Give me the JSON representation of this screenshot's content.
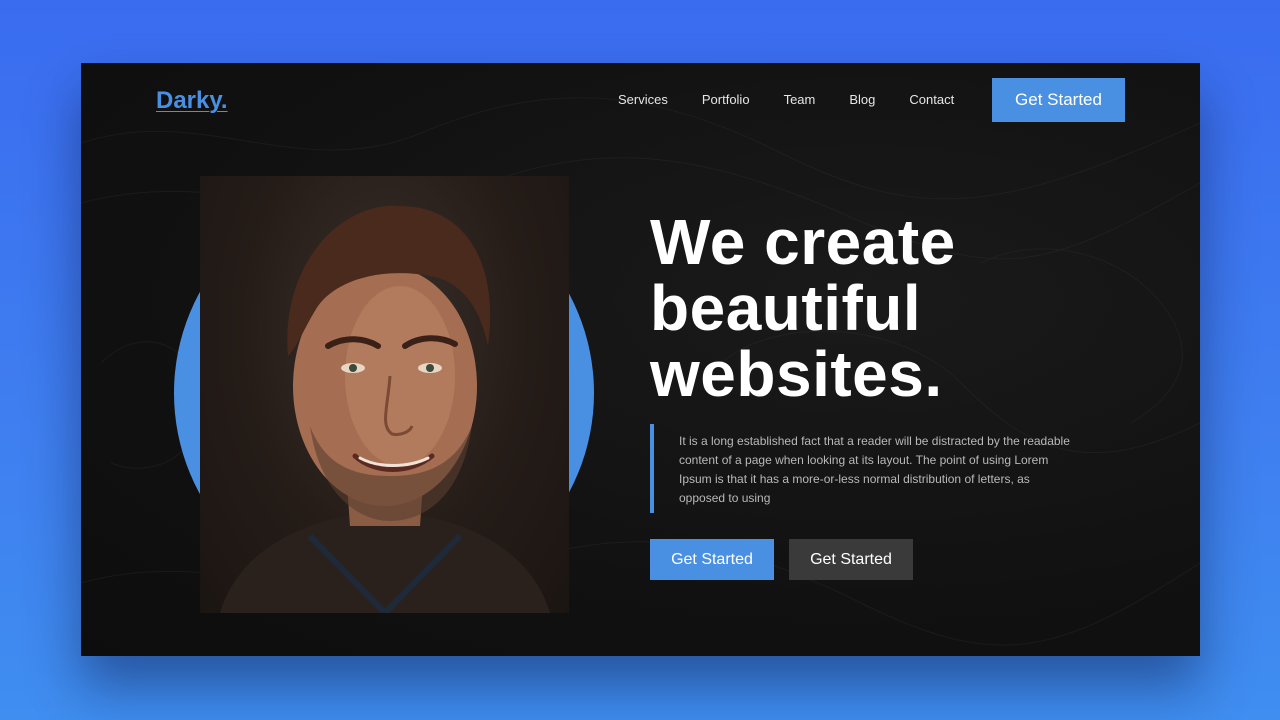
{
  "header": {
    "logo": "Darky.",
    "nav": [
      "Services",
      "Portfolio",
      "Team",
      "Blog",
      "Contact"
    ],
    "cta": "Get Started"
  },
  "hero": {
    "title_lines": [
      "We create",
      "beautiful",
      "websites."
    ],
    "description": "It is a long established fact that a reader will be distracted by the readable content of a page when looking at its layout. The point of using Lorem Ipsum is that it has a more-or-less normal distribution of letters, as opposed to using",
    "primary_button": "Get Started",
    "secondary_button": "Get Started"
  },
  "colors": {
    "page_background": "#3a6cf0",
    "frame_background": "#111111",
    "accent": "#4a90e2",
    "secondary_button": "#3a3a3a"
  }
}
